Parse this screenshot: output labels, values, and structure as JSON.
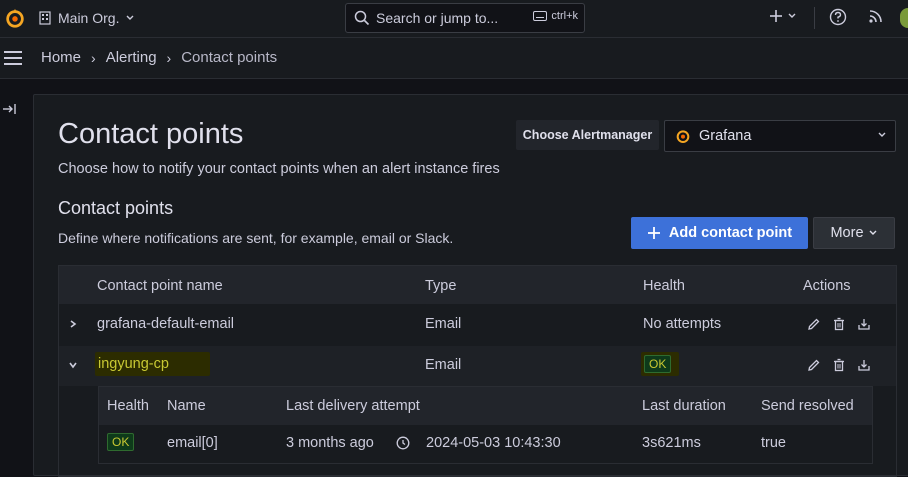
{
  "topbar": {
    "org_name": "Main Org.",
    "search_placeholder": "Search or jump to...",
    "search_shortcut": "ctrl+k"
  },
  "breadcrumbs": [
    "Home",
    "Alerting",
    "Contact points"
  ],
  "page": {
    "title": "Contact points",
    "subtitle": "Choose how to notify your contact points when an alert instance fires",
    "alertmanager_label": "Choose Alertmanager",
    "alertmanager_value": "Grafana"
  },
  "section": {
    "title": "Contact points",
    "description": "Define where notifications are sent, for example, email or Slack.",
    "add_button": "Add contact point",
    "more_button": "More"
  },
  "table": {
    "headers": [
      "Contact point name",
      "Type",
      "Health",
      "Actions"
    ],
    "rows": [
      {
        "name": "grafana-default-email",
        "type": "Email",
        "health": "No attempts",
        "expanded": false
      },
      {
        "name": "ingyung-cp",
        "type": "Email",
        "health": "OK",
        "expanded": true
      }
    ]
  },
  "details": {
    "headers": [
      "Health",
      "Name",
      "Last delivery attempt",
      "Last duration",
      "Send resolved"
    ],
    "rows": [
      {
        "health": "OK",
        "name": "email[0]",
        "last_attempt_relative": "3 months ago",
        "last_attempt_time": "2024-05-03 10:43:30",
        "duration": "3s621ms",
        "send_resolved": "true"
      }
    ]
  },
  "colors": {
    "primary": "#3d71d9",
    "background": "#111217",
    "panel": "#181b1f",
    "highlight": "#2c2c00",
    "ok_badge": "#0e3a1a"
  }
}
